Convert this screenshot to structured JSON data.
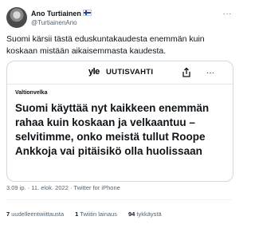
{
  "author": {
    "display_name": "Ano Turtiainen",
    "handle": "@TurtiainenAno"
  },
  "tweet": {
    "text": "Suomi kärsii tästä eduskuntakaudesta enemmän kuin koskaan mistään aikaisemmasta kaudesta.",
    "more_label": "···"
  },
  "card": {
    "logo_text": "yle",
    "source_name": "UUTISVAHTI",
    "category": "Valtionvelka",
    "headline": "Suomi käyttää nyt kaikkeen enemmän rahaa kuin koskaan ja velkaantuu – selvitimme, onko meistä tullut Roope Ankkoja vai pitäisikö olla huolissaan",
    "more_label": "···"
  },
  "meta": {
    "time": "3.09 ip.",
    "date": "11. elok. 2022",
    "client": "Twitter for iPhone"
  },
  "stats": {
    "retweets_count": "7",
    "retweets_label": "uudelleentwiittausta",
    "quotes_count": "1",
    "quotes_label": "Twiitin lainaus",
    "likes_count": "94",
    "likes_label": "tykkäystä"
  },
  "icons": {
    "flag": "finland-flag-icon",
    "share": "share-icon",
    "more": "more-icon"
  }
}
